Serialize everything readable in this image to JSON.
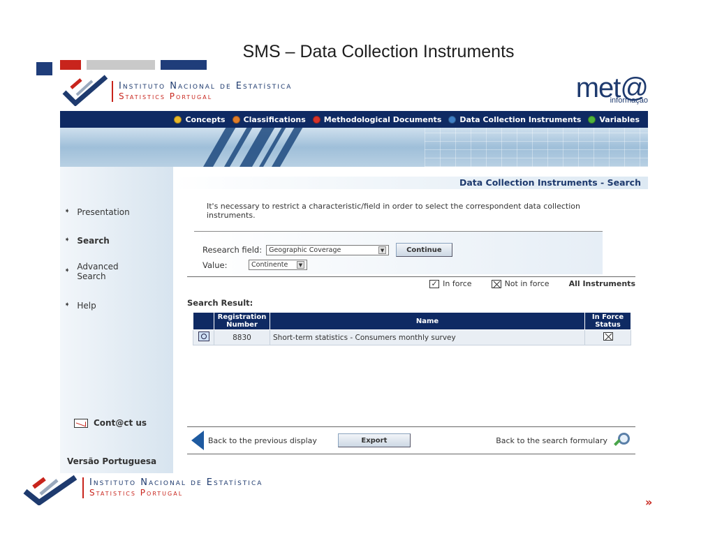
{
  "slide": {
    "title": "SMS – Data Collection Instruments",
    "next_label": "»"
  },
  "colors": {
    "navy": "#0f2a63",
    "red": "#c8241c"
  },
  "header": {
    "ine_line1": "Instituto Nacional de Estatística",
    "ine_line2": "Statistics Portugal",
    "meta_logo": "met@",
    "meta_sub": "informação"
  },
  "nav": {
    "items": [
      {
        "label": "Concepts",
        "dot": "#e8b82a"
      },
      {
        "label": "Classifications",
        "dot": "#e07d2a"
      },
      {
        "label": "Methodological Documents",
        "dot": "#d6332a"
      },
      {
        "label": "Data Collection Instruments",
        "dot": "#3f7fc5"
      },
      {
        "label": "Variables",
        "dot": "#4fb43a"
      }
    ]
  },
  "sidebar": {
    "items": [
      {
        "label": "Presentation"
      },
      {
        "label": "Search"
      },
      {
        "label": "Advanced Search"
      },
      {
        "label": "Help"
      }
    ],
    "contact": "Cont@ct us",
    "language": "Versão Portuguesa"
  },
  "content": {
    "page_title": "Data Collection Instruments - Search",
    "intro": "It's necessary to restrict a characteristic/field in order to select the correspondent data collection instruments.",
    "form": {
      "research_label": "Research field:",
      "research_value": "Geographic Coverage",
      "value_label": "Value:",
      "value_value": "Continente",
      "continue_label": "Continue"
    },
    "legend": {
      "in_force": "In force",
      "not_in_force": "Not in force",
      "all": "All Instruments"
    },
    "result_title": "Search Result:",
    "table": {
      "headers": [
        "Registration Number",
        "Name",
        "In Force Status"
      ],
      "rows": [
        {
          "number": "8830",
          "name": "Short-term statistics - Consumers monthly survey"
        }
      ]
    },
    "footer": {
      "back_prev": "Back to the previous display",
      "export": "Export",
      "back_search": "Back to the search formulary"
    }
  }
}
